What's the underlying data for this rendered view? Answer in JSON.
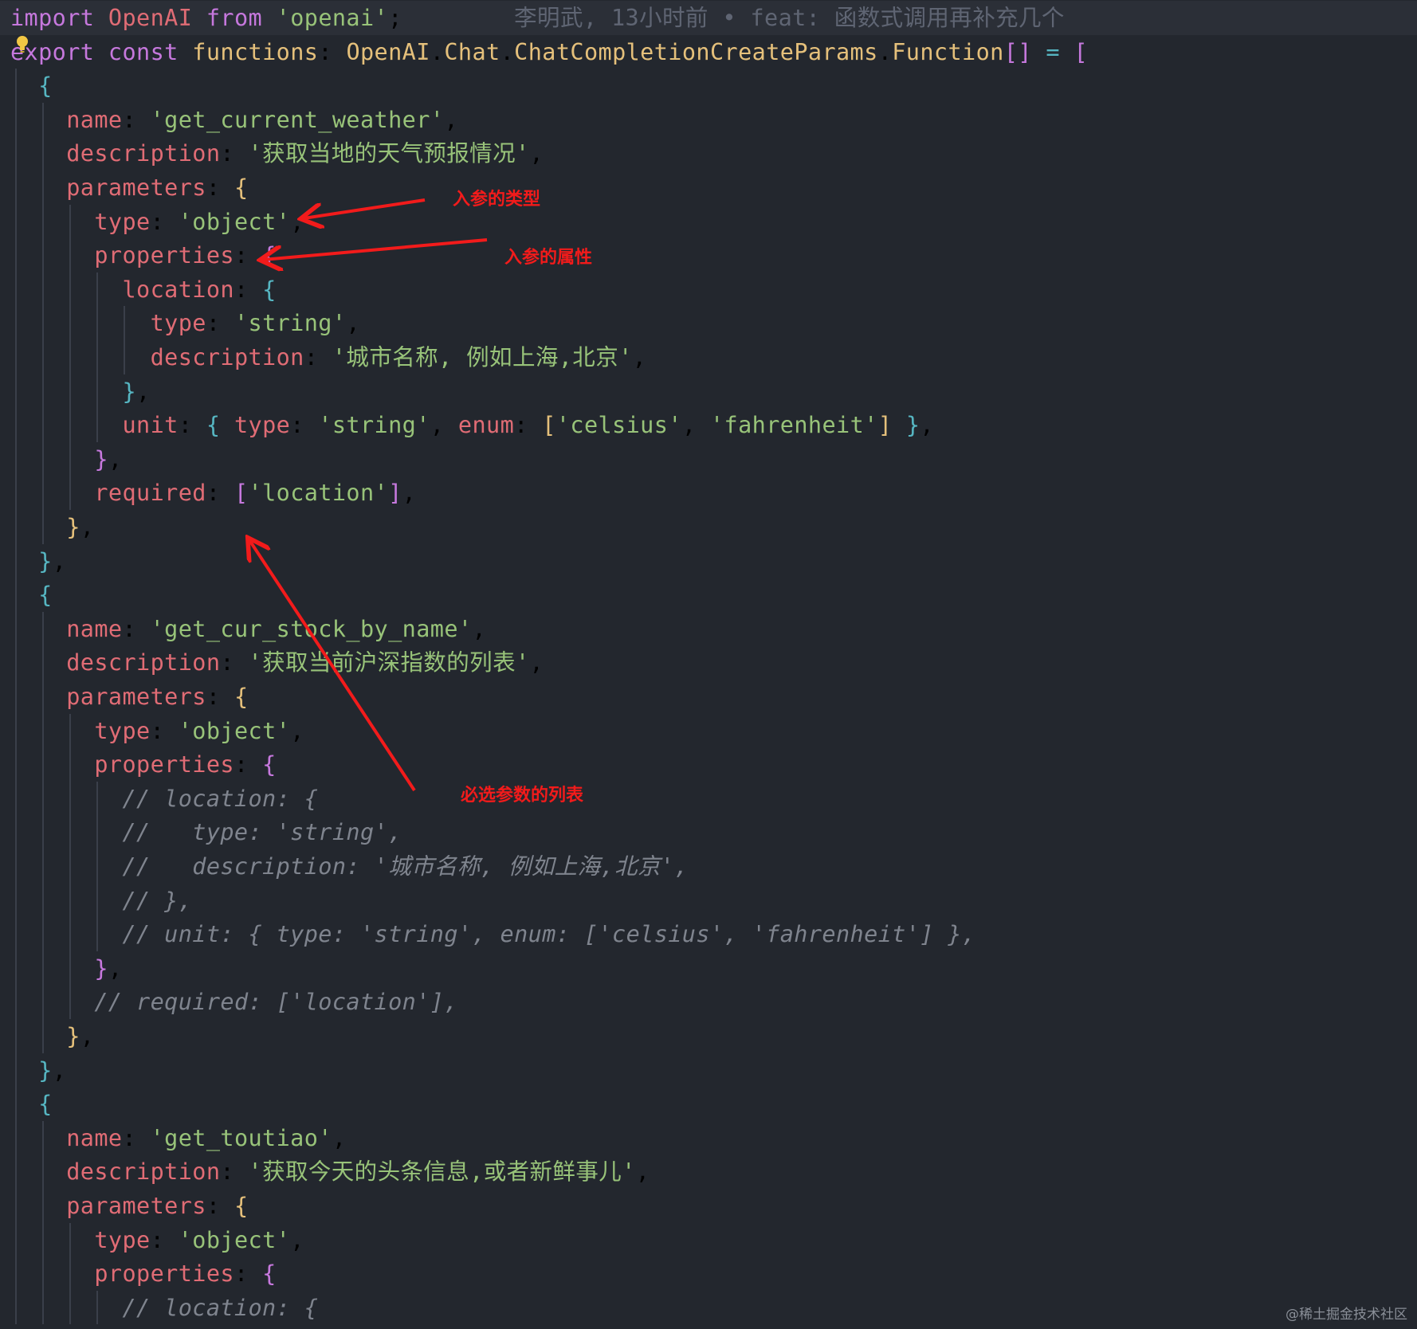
{
  "editor": {
    "blame": "李明武, 13小时前 • feat: 函数式调用再补充几个",
    "lines": [
      "import OpenAI from 'openai';",
      "export const functions: OpenAI.Chat.ChatCompletionCreateParams.Function[] = [",
      "  {",
      "    name: 'get_current_weather',",
      "    description: '获取当地的天气预报情况',",
      "    parameters: {",
      "      type: 'object',",
      "      properties: {",
      "        location: {",
      "          type: 'string',",
      "          description: '城市名称, 例如上海,北京',",
      "        },",
      "        unit: { type: 'string', enum: ['celsius', 'fahrenheit'] },",
      "      },",
      "      required: ['location'],",
      "    },",
      "  },",
      "  {",
      "    name: 'get_cur_stock_by_name',",
      "    description: '获取当前沪深指数的列表',",
      "    parameters: {",
      "      type: 'object',",
      "      properties: {",
      "        // location: {",
      "        //   type: 'string',",
      "        //   description: '城市名称, 例如上海,北京',",
      "        // },",
      "        // unit: { type: 'string', enum: ['celsius', 'fahrenheit'] },",
      "      },",
      "      // required: ['location'],",
      "    },",
      "  },",
      "  {",
      "    name: 'get_toutiao',",
      "    description: '获取今天的头条信息,或者新鲜事儿',",
      "    parameters: {",
      "      type: 'object',",
      "      properties: {",
      "        // location: {"
    ]
  },
  "annotations": {
    "param_type": "入参的类型",
    "param_properties": "入参的属性",
    "required_list": "必选参数的列表"
  },
  "watermark": "@稀土掘金技术社区",
  "colors": {
    "background": "#23272e",
    "keyword": "#c678dd",
    "type": "#e5c07b",
    "property": "#e06c75",
    "string": "#98c379",
    "comment": "#7f848e",
    "annotation_red": "#f21b1b"
  }
}
